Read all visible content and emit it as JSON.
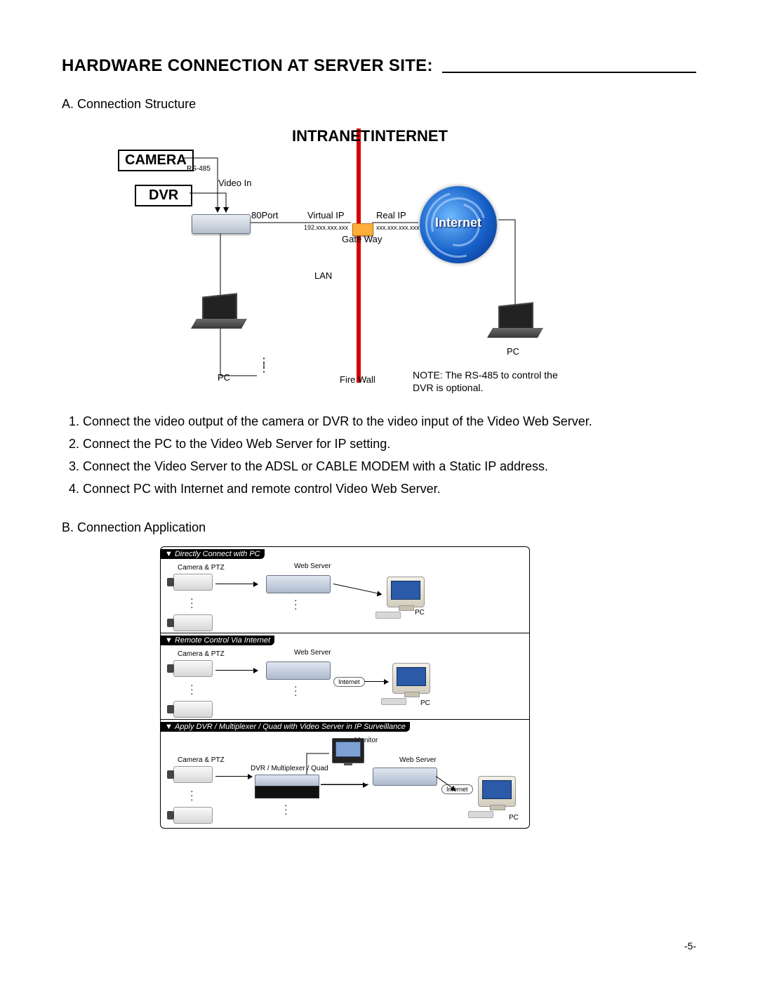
{
  "page": {
    "title": "HARDWARE CONNECTION AT SERVER SITE: ",
    "number": "-5-"
  },
  "sectionA": {
    "heading": "A. Connection Structure",
    "labels": {
      "camera_box": "CAMERA",
      "dvr_box": "DVR",
      "rs485": "RS-485",
      "video_in": "Video In",
      "port80": "80Port",
      "intranet": "INTRANET",
      "internet_top": "INTERNET",
      "virtual_ip": "Virtual IP",
      "real_ip": "Real IP",
      "virtual_ip_val": "192.xxx.xxx.xxx",
      "real_ip_val": "xxx.xxx.xxx.xxx",
      "gateway": "Gate Way",
      "lan": "LAN",
      "internet_swirl": "Internet",
      "pc_left": "PC",
      "pc_right": "PC",
      "firewall": "Fire Wall",
      "note": "NOTE:  The RS-485 to control the DVR is optional."
    }
  },
  "steps": [
    "1. Connect the video output of the camera or DVR to the video input of the Video Web Server.",
    "2. Connect the PC to the Video Web Server for IP setting.",
    "3. Connect  the Video Server to the ADSL or CABLE MODEM with a Static IP address.",
    "4. Connect PC with Internet and remote control Video Web Server."
  ],
  "sectionB": {
    "heading": "B. Connection Application",
    "panels": [
      {
        "title": "Directly Connect with PC",
        "camera_label": "Camera & PTZ",
        "server_label": "Web Server",
        "pc_label": "PC"
      },
      {
        "title": "Remote Control Via Internet",
        "camera_label": "Camera & PTZ",
        "server_label": "Web Server",
        "internet_label": "Internet",
        "pc_label": "PC"
      },
      {
        "title": "Apply DVR / Multiplexer / Quad with Video Server in IP Surveillance",
        "camera_label": "Camera & PTZ",
        "dvr_label": "DVR / Multiplexer / Quad",
        "monitor_label": "Monitor",
        "server_label": "Web Server",
        "internet_label": "Internet",
        "pc_label": "PC"
      }
    ]
  }
}
